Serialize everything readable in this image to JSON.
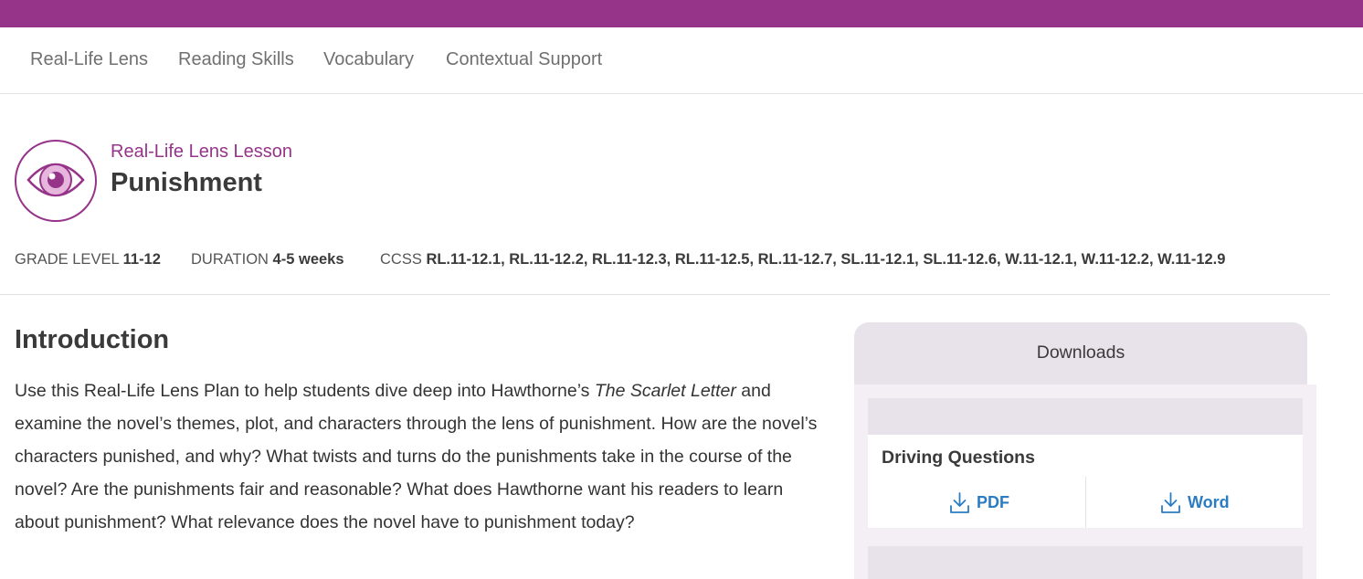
{
  "colors": {
    "brand": "#96348a",
    "link": "#2b7cc1",
    "panel": "#e8e3ea"
  },
  "subnav": {
    "items": [
      {
        "label": "Real-Life Lens"
      },
      {
        "label": "Reading Skills"
      },
      {
        "label": "Vocabulary"
      },
      {
        "label": "Contextual Support"
      }
    ]
  },
  "lesson": {
    "icon": "eye-icon",
    "type": "Real-Life Lens Lesson",
    "title": "Punishment"
  },
  "meta": {
    "grade_label": "GRADE LEVEL",
    "grade_value": "11-12",
    "duration_label": "DURATION",
    "duration_value": "4-5 weeks",
    "ccss_label": "CCSS",
    "ccss_value": "RL.11-12.1, RL.11-12.2, RL.11-12.3, RL.11-12.5, RL.11-12.7, SL.11-12.1, SL.11-12.6, W.11-12.1, W.11-12.2, W.11-12.9"
  },
  "intro": {
    "heading": "Introduction",
    "text_before": "Use this Real-Life Lens Plan to help students dive deep into Hawthorne’s ",
    "book_title": "The Scarlet Letter",
    "text_after": " and examine the novel’s themes, plot, and characters through the lens of punishment. How are the novel’s characters punished, and why? What twists and turns do the punishments take in the course of the novel? Are the punishments fair and reasonable? What does Hawthorne want his readers to learn about punishment? What relevance does the novel have to punishment today?"
  },
  "downloads": {
    "title": "Downloads",
    "items": [
      {
        "title": "Driving Questions",
        "pdf_label": "PDF",
        "word_label": "Word",
        "icon": "download-icon"
      }
    ]
  }
}
